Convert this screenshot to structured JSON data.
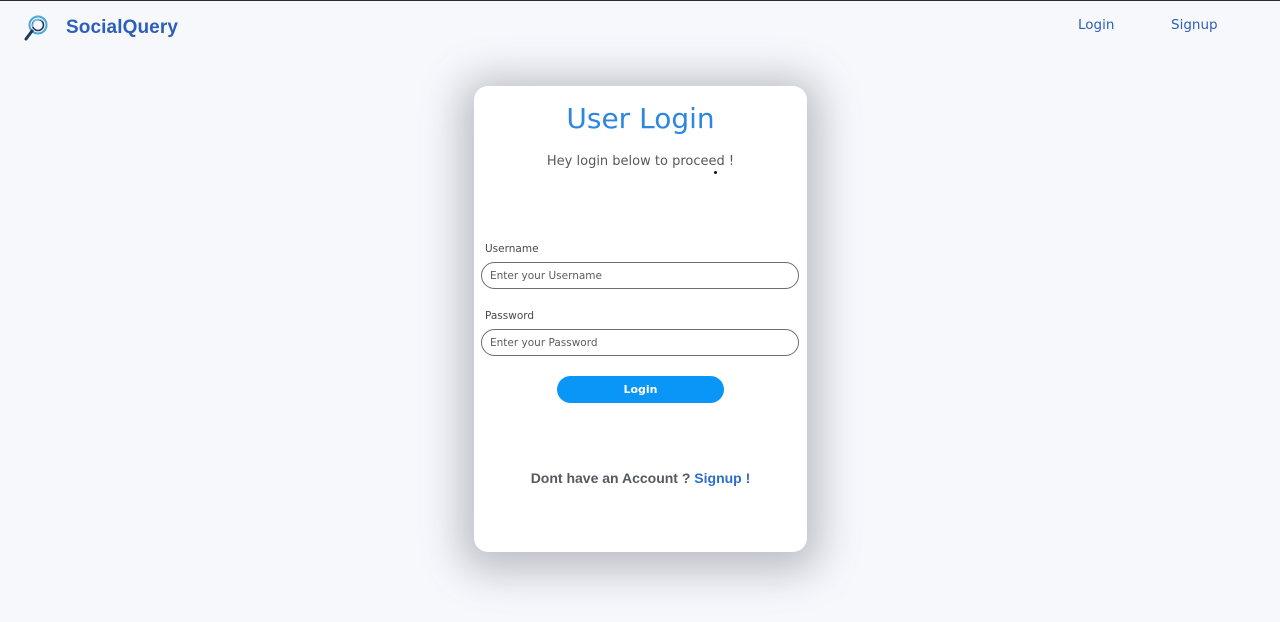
{
  "navbar": {
    "brand_name": "SocialQuery",
    "links": {
      "login": "Login",
      "signup": "Signup"
    }
  },
  "card": {
    "title": "User Login",
    "subtitle": "Hey login below to proceed !",
    "username": {
      "label": "Username",
      "placeholder": "Enter your Username",
      "value": ""
    },
    "password": {
      "label": "Password",
      "placeholder": "Enter your Password",
      "value": ""
    },
    "login_button": "Login",
    "signup_prompt": "Dont have an Account ?",
    "signup_link": "Signup !"
  },
  "colors": {
    "brand": "#2d5fb8",
    "title": "#2d86e0",
    "button": "#0a96f7",
    "background": "#f6f8fc"
  },
  "icons": {
    "brand_logo": "magnifier-logo-icon"
  }
}
